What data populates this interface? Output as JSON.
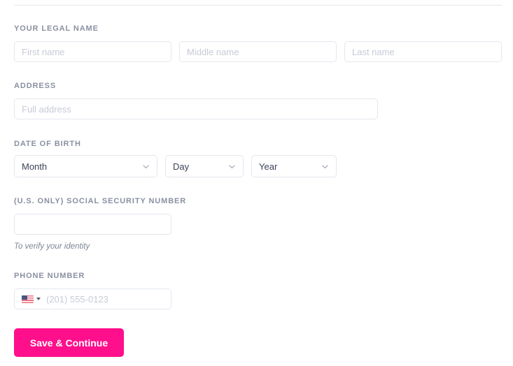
{
  "theme": {
    "accent": "#FF0F8C",
    "label_color": "#8a90a2",
    "border_color": "#e3e7ee",
    "placeholder_color": "#c7cbd6",
    "value_color": "#3c4257",
    "divider_color": "#e6e8ec",
    "background": "#ffffff"
  },
  "form": {
    "legal_name": {
      "label": "YOUR LEGAL NAME",
      "first": {
        "placeholder": "First name",
        "value": ""
      },
      "middle": {
        "placeholder": "Middle name",
        "value": ""
      },
      "last": {
        "placeholder": "Last name",
        "value": ""
      }
    },
    "address": {
      "label": "ADDRESS",
      "full": {
        "placeholder": "Full address",
        "value": ""
      }
    },
    "date_of_birth": {
      "label": "DATE OF BIRTH",
      "month": {
        "selected": "Month",
        "icon": "chevron-down-icon"
      },
      "day": {
        "selected": "Day",
        "icon": "chevron-down-icon"
      },
      "year": {
        "selected": "Year",
        "icon": "chevron-down-icon"
      }
    },
    "ssn": {
      "label": "(U.S. ONLY) SOCIAL SECURITY NUMBER",
      "placeholder": "",
      "value": "",
      "helper": "To verify your identity"
    },
    "phone": {
      "label": "PHONE NUMBER",
      "country_flag_icon": "us-flag-icon",
      "country_caret_icon": "caret-down-icon",
      "placeholder": "(201) 555-0123",
      "value": ""
    },
    "submit": {
      "label": "Save & Continue"
    }
  }
}
